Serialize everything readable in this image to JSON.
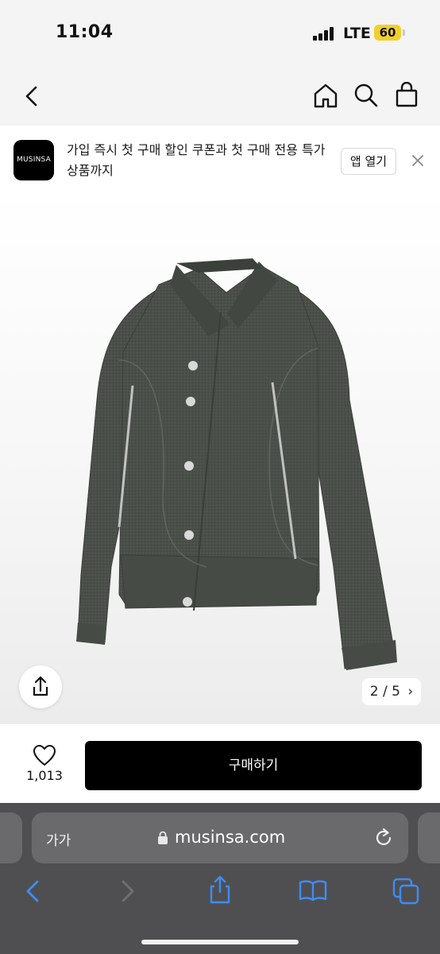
{
  "status": {
    "time": "11:04",
    "network": "LTE",
    "battery": "60"
  },
  "nav": {
    "back_icon": "chevron-left-icon",
    "home_icon": "home-icon",
    "search_icon": "search-icon",
    "cart_icon": "bag-icon"
  },
  "banner": {
    "logo": "MUSINSA",
    "text": "가입 즉시 첫 구매 할인 쿠폰과 첫 구매 전용 특가 상품까지",
    "open_app": "앱 열기"
  },
  "gallery": {
    "counter": "2 / 5"
  },
  "purchase": {
    "like_count": "1,013",
    "buy_label": "구매하기"
  },
  "browser": {
    "text_size": "가가",
    "url": "musinsa.com"
  },
  "colors": {
    "accent_button": "#000000",
    "battery": "#f3cf2c",
    "safari_bg": "#4f4f52",
    "ios_blue": "#3d8df5"
  }
}
